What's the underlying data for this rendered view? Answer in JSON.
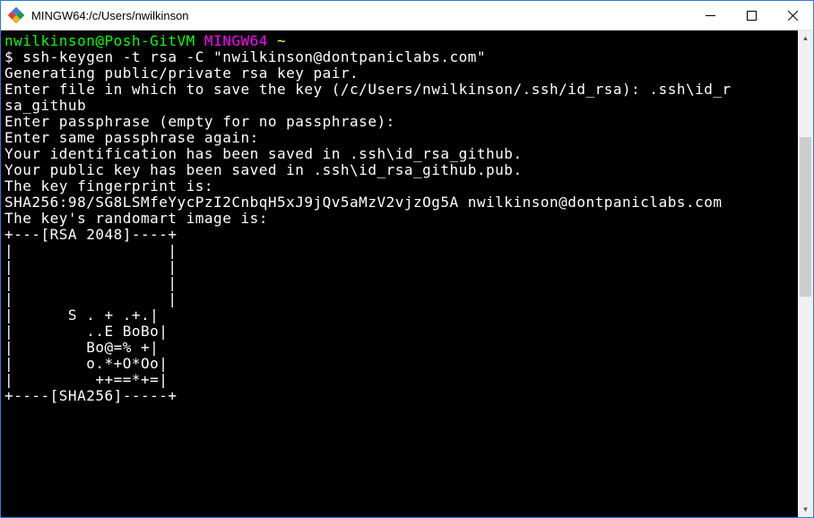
{
  "window": {
    "title": "MINGW64:/c/Users/nwilkinson"
  },
  "prompt": {
    "user_host": "nwilkinson@Posh-GitVM",
    "env": "MINGW64",
    "path": "~",
    "symbol": "$"
  },
  "command": "ssh-keygen -t rsa -C \"nwilkinson@dontpaniclabs.com\"",
  "output": {
    "l1": "Generating public/private rsa key pair.",
    "l2": "Enter file in which to save the key (/c/Users/nwilkinson/.ssh/id_rsa): .ssh\\id_r",
    "l3": "sa_github",
    "l4": "Enter passphrase (empty for no passphrase):",
    "l5": "Enter same passphrase again:",
    "l6": "Your identification has been saved in .ssh\\id_rsa_github.",
    "l7": "Your public key has been saved in .ssh\\id_rsa_github.pub.",
    "l8": "The key fingerprint is:",
    "l9": "SHA256:98/SG8LSMfeYycPzI2CnbqH5xJ9jQv5aMzV2vjzOg5A nwilkinson@dontpaniclabs.com",
    "l10": "The key's randomart image is:",
    "l11": "+---[RSA 2048]----+",
    "l12": "|                 |",
    "l13": "|                 |",
    "l14": "|                 |",
    "l15": "|                 |",
    "l16": "|      S . + .+.|",
    "l17": "|        ..E BoBo|",
    "l18": "|        Bo@=% +|",
    "l19": "|        o.*+O*Oo|",
    "l20": "|         ++==*+=|",
    "l21": "+----[SHA256]-----+"
  }
}
